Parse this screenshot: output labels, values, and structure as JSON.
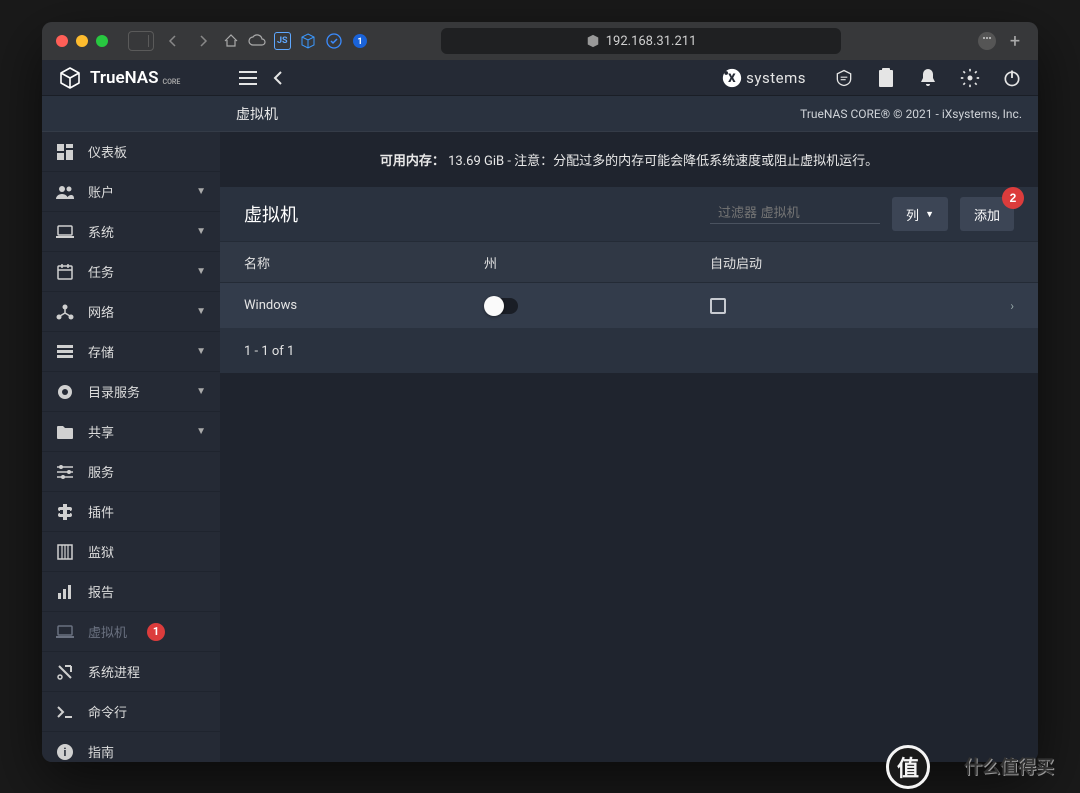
{
  "browser": {
    "url": "192.168.31.211"
  },
  "header": {
    "brand": "TrueNAS",
    "brand_sub": "CORE",
    "vendor": "systems"
  },
  "subheader": {
    "title": "虚拟机",
    "copyright": "TrueNAS CORE® © 2021 - iXsystems, Inc."
  },
  "sidebar": {
    "items": [
      {
        "label": "仪表板",
        "icon": "dashboard",
        "expandable": false
      },
      {
        "label": "账户",
        "icon": "people",
        "expandable": true
      },
      {
        "label": "系统",
        "icon": "laptop",
        "expandable": true
      },
      {
        "label": "任务",
        "icon": "calendar",
        "expandable": true
      },
      {
        "label": "网络",
        "icon": "network",
        "expandable": true
      },
      {
        "label": "存储",
        "icon": "storage",
        "expandable": true
      },
      {
        "label": "目录服务",
        "icon": "globe",
        "expandable": true
      },
      {
        "label": "共享",
        "icon": "folder",
        "expandable": true
      },
      {
        "label": "服务",
        "icon": "tune",
        "expandable": false
      },
      {
        "label": "插件",
        "icon": "plugin",
        "expandable": false
      },
      {
        "label": "监狱",
        "icon": "jail",
        "expandable": false
      },
      {
        "label": "报告",
        "icon": "chart",
        "expandable": false
      },
      {
        "label": "虚拟机",
        "icon": "laptop",
        "expandable": false,
        "active": true,
        "badge": "1"
      },
      {
        "label": "系统进程",
        "icon": "process",
        "expandable": false
      },
      {
        "label": "命令行",
        "icon": "cli",
        "expandable": false
      },
      {
        "label": "指南",
        "icon": "info",
        "expandable": false
      }
    ]
  },
  "memory": {
    "label": "可用内存：",
    "value": "13.69 GiB",
    "warning": " - 注意：分配过多的内存可能会降低系统速度或阻止虚拟机运行。"
  },
  "panel": {
    "title": "虚拟机",
    "filter_placeholder": "过滤器 虚拟机",
    "columns_btn": "列",
    "add_btn": "添加",
    "add_badge": "2"
  },
  "table": {
    "headers": {
      "name": "名称",
      "state": "州",
      "autostart": "自动启动"
    },
    "rows": [
      {
        "name": "Windows",
        "running": false,
        "autostart": false
      }
    ],
    "pagination": "1 - 1 of 1"
  },
  "watermark": {
    "icon": "值",
    "text": "什么值得买"
  }
}
